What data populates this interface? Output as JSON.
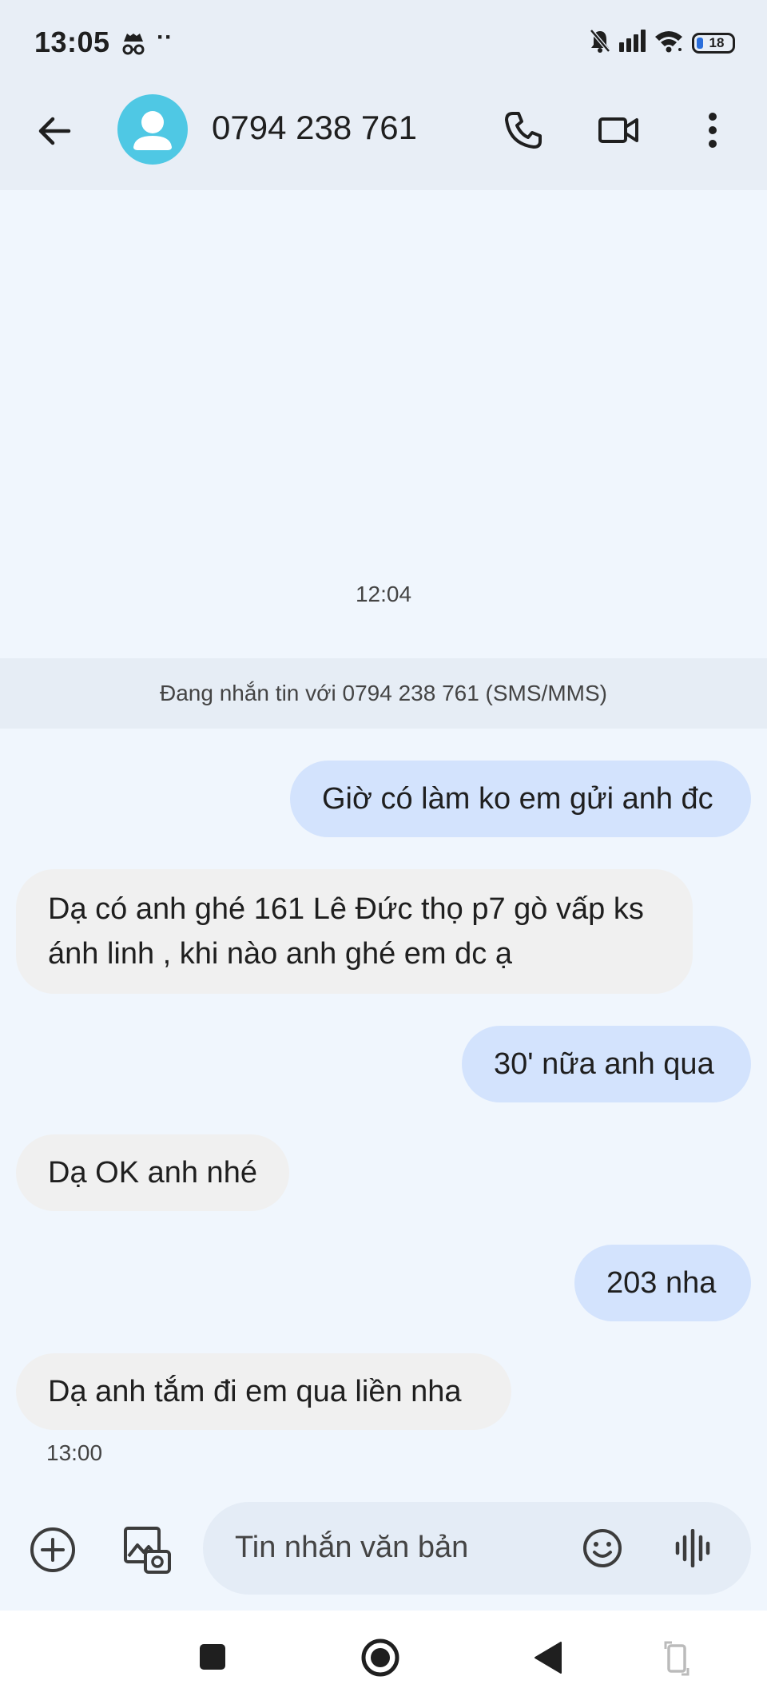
{
  "status_bar": {
    "time": "13:05",
    "dots": "··",
    "battery": "18"
  },
  "header": {
    "contact": "0794 238 761",
    "icons": [
      "back-arrow-icon",
      "avatar-icon",
      "phone-icon",
      "video-call-icon",
      "more-vert-icon"
    ]
  },
  "conversation": {
    "timestamp_top": "12:04",
    "banner": "Đang nhắn tin với 0794 238 761 (SMS/MMS)",
    "messages": [
      {
        "dir": "out",
        "text": "Giờ có làm ko em gửi anh đc"
      },
      {
        "dir": "in",
        "line1": "Dạ có  anh ghé 161 Lê Đức thọ p7 gò vấp ks",
        "line2": "ánh linh , khi nào anh ghé em dc ạ"
      },
      {
        "dir": "out",
        "text": "30' nữa anh qua"
      },
      {
        "dir": "in",
        "text": "Dạ OK anh nhé"
      },
      {
        "dir": "out",
        "text": "203 nha"
      },
      {
        "dir": "in",
        "text": "Dạ anh tắm đi em qua liền nha"
      }
    ],
    "timestamp_bottom": "13:00"
  },
  "compose": {
    "placeholder": "Tin nhắn văn bản",
    "icons": [
      "add-circle-icon",
      "gallery-icon",
      "emoji-icon",
      "voice-icon"
    ]
  },
  "nav": {
    "icons": [
      "recents-square-icon",
      "home-circle-icon",
      "back-triangle-icon",
      "rotate-icon"
    ]
  },
  "colors": {
    "background": "#f0f6fd",
    "outgoing_bubble": "#d3e3fd",
    "incoming_bubble": "#f0f0f0",
    "avatar": "#4fc8e4",
    "battery_fill": "#2a6edb"
  }
}
